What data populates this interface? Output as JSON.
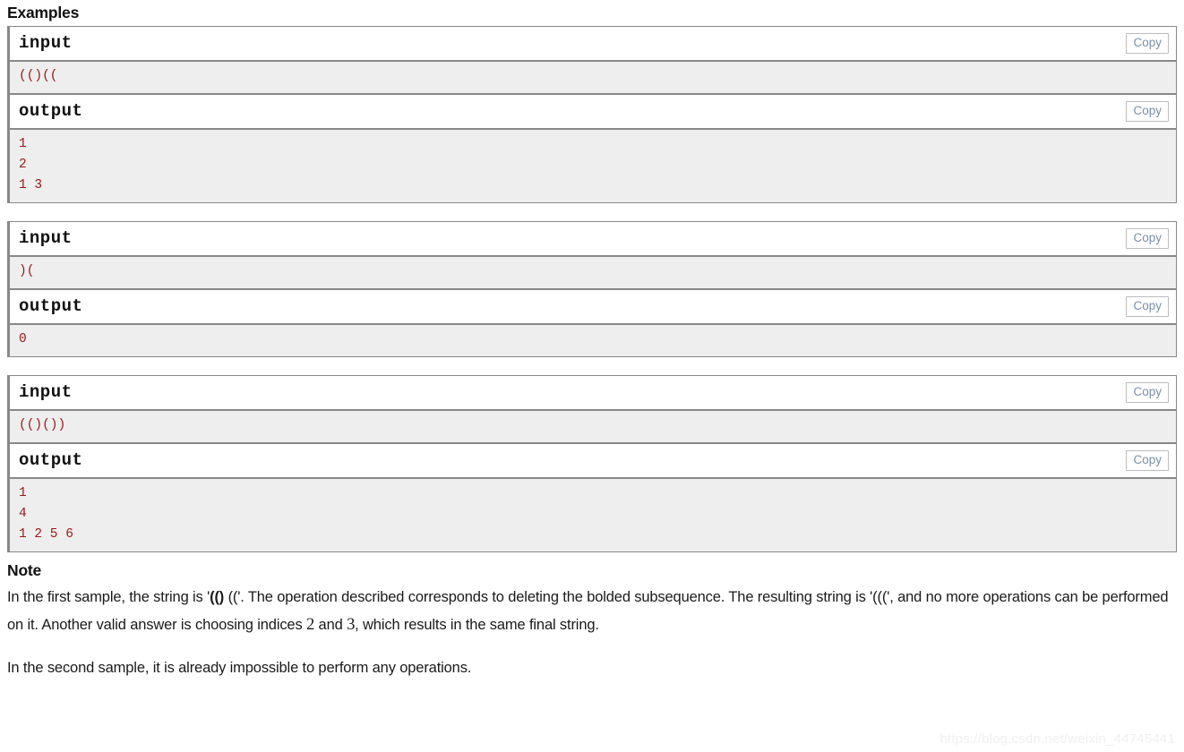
{
  "examples": {
    "heading": "Examples",
    "copy_label": "Copy",
    "input_label": "input",
    "output_label": "output",
    "tests": [
      {
        "input": "(()((",
        "output": "1\n2\n1 3"
      },
      {
        "input": ")(",
        "output": "0"
      },
      {
        "input": "(()())",
        "output": "1\n4\n1 2 5 6"
      }
    ]
  },
  "note": {
    "heading": "Note",
    "paragraph1": {
      "part1": "In the first sample, the string is '",
      "bold_brackets": "(()",
      "part2": " ((",
      "part3": "'. The operation described corresponds to deleting the bolded subsequence. The resulting string is '(((",
      "part4": "', and no more operations can be performed on it. Another valid answer is choosing indices ",
      "num1": "2",
      "part5": " and ",
      "num2": "3",
      "part6": ", which results in the same final string."
    },
    "paragraph2": "In the second sample, it is already impossible to perform any operations."
  },
  "watermark": "https://blog.csdn.net/weixin_44745441"
}
